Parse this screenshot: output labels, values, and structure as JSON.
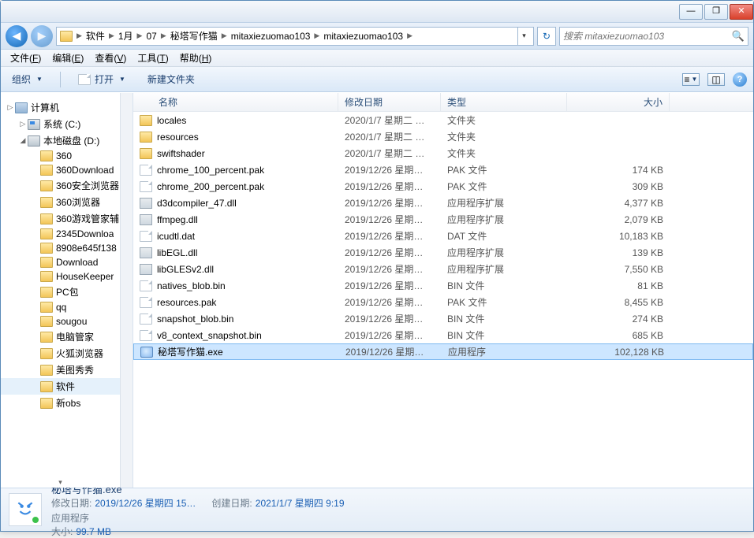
{
  "window_controls": {
    "min": "—",
    "max": "❐",
    "close": "✕"
  },
  "breadcrumb": [
    "软件",
    "1月",
    "07",
    "秘塔写作猫",
    "mitaxiezuomao103",
    "mitaxiezuomao103"
  ],
  "search_placeholder": "搜索 mitaxiezuomao103",
  "menus": [
    {
      "label": "文件",
      "key": "F"
    },
    {
      "label": "编辑",
      "key": "E"
    },
    {
      "label": "查看",
      "key": "V"
    },
    {
      "label": "工具",
      "key": "T"
    },
    {
      "label": "帮助",
      "key": "H"
    }
  ],
  "toolbar": {
    "organize": "组织",
    "open": "打开",
    "newfolder": "新建文件夹"
  },
  "tree": [
    {
      "label": "计算机",
      "icon": "computer",
      "indent": 0,
      "exp": "▷"
    },
    {
      "label": "系统 (C:)",
      "icon": "drive c",
      "indent": 1,
      "exp": "▷"
    },
    {
      "label": "本地磁盘 (D:)",
      "icon": "drive",
      "indent": 1,
      "exp": "◢"
    },
    {
      "label": "360",
      "icon": "folder",
      "indent": 2
    },
    {
      "label": "360Download",
      "icon": "folder",
      "indent": 2
    },
    {
      "label": "360安全浏览器",
      "icon": "folder",
      "indent": 2
    },
    {
      "label": "360浏览器",
      "icon": "folder",
      "indent": 2
    },
    {
      "label": "360游戏管家辅",
      "icon": "folder",
      "indent": 2
    },
    {
      "label": "2345Downloa",
      "icon": "folder",
      "indent": 2
    },
    {
      "label": "8908e645f138",
      "icon": "folder",
      "indent": 2
    },
    {
      "label": "Download",
      "icon": "folder",
      "indent": 2
    },
    {
      "label": "HouseKeeper",
      "icon": "folder",
      "indent": 2
    },
    {
      "label": "PC包",
      "icon": "folder",
      "indent": 2
    },
    {
      "label": "qq",
      "icon": "folder",
      "indent": 2
    },
    {
      "label": "sougou",
      "icon": "folder",
      "indent": 2
    },
    {
      "label": "电脑管家",
      "icon": "folder",
      "indent": 2
    },
    {
      "label": "火狐浏览器",
      "icon": "folder",
      "indent": 2
    },
    {
      "label": "美图秀秀",
      "icon": "folder",
      "indent": 2
    },
    {
      "label": "软件",
      "icon": "folder",
      "indent": 2,
      "sel": true
    },
    {
      "label": "新obs",
      "icon": "folder",
      "indent": 2
    }
  ],
  "columns": {
    "name": "名称",
    "date": "修改日期",
    "type": "类型",
    "size": "大小"
  },
  "files": [
    {
      "name": "locales",
      "date": "2020/1/7 星期二 …",
      "type": "文件夹",
      "size": "",
      "icon": "folder"
    },
    {
      "name": "resources",
      "date": "2020/1/7 星期二 …",
      "type": "文件夹",
      "size": "",
      "icon": "folder"
    },
    {
      "name": "swiftshader",
      "date": "2020/1/7 星期二 …",
      "type": "文件夹",
      "size": "",
      "icon": "folder"
    },
    {
      "name": "chrome_100_percent.pak",
      "date": "2019/12/26 星期…",
      "type": "PAK 文件",
      "size": "174 KB",
      "icon": "file"
    },
    {
      "name": "chrome_200_percent.pak",
      "date": "2019/12/26 星期…",
      "type": "PAK 文件",
      "size": "309 KB",
      "icon": "file"
    },
    {
      "name": "d3dcompiler_47.dll",
      "date": "2019/12/26 星期…",
      "type": "应用程序扩展",
      "size": "4,377 KB",
      "icon": "dll"
    },
    {
      "name": "ffmpeg.dll",
      "date": "2019/12/26 星期…",
      "type": "应用程序扩展",
      "size": "2,079 KB",
      "icon": "dll"
    },
    {
      "name": "icudtl.dat",
      "date": "2019/12/26 星期…",
      "type": "DAT 文件",
      "size": "10,183 KB",
      "icon": "file"
    },
    {
      "name": "libEGL.dll",
      "date": "2019/12/26 星期…",
      "type": "应用程序扩展",
      "size": "139 KB",
      "icon": "dll"
    },
    {
      "name": "libGLESv2.dll",
      "date": "2019/12/26 星期…",
      "type": "应用程序扩展",
      "size": "7,550 KB",
      "icon": "dll"
    },
    {
      "name": "natives_blob.bin",
      "date": "2019/12/26 星期…",
      "type": "BIN 文件",
      "size": "81 KB",
      "icon": "file"
    },
    {
      "name": "resources.pak",
      "date": "2019/12/26 星期…",
      "type": "PAK 文件",
      "size": "8,455 KB",
      "icon": "file"
    },
    {
      "name": "snapshot_blob.bin",
      "date": "2019/12/26 星期…",
      "type": "BIN 文件",
      "size": "274 KB",
      "icon": "file"
    },
    {
      "name": "v8_context_snapshot.bin",
      "date": "2019/12/26 星期…",
      "type": "BIN 文件",
      "size": "685 KB",
      "icon": "file"
    },
    {
      "name": "秘塔写作猫.exe",
      "date": "2019/12/26 星期…",
      "type": "应用程序",
      "size": "102,128 KB",
      "icon": "exe",
      "selected": true
    }
  ],
  "details": {
    "name": "秘塔写作猫.exe",
    "type": "应用程序",
    "labels": {
      "modified": "修改日期:",
      "created": "创建日期:",
      "size": "大小:"
    },
    "modified": "2019/12/26 星期四 15…",
    "created": "2021/1/7 星期四 9:19",
    "size": "99.7 MB"
  }
}
